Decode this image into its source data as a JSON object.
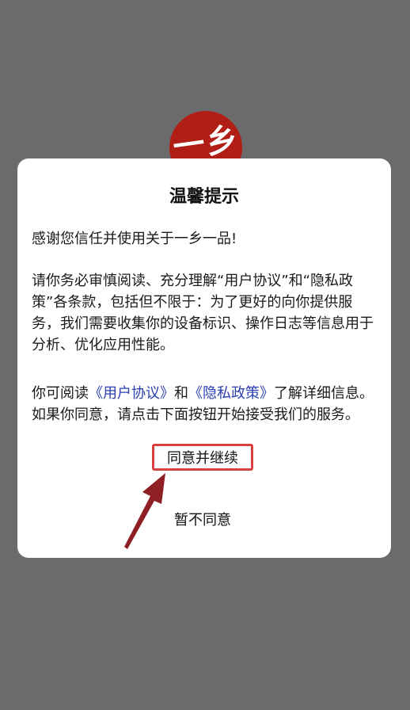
{
  "logo": {
    "text": "一乡"
  },
  "dialog": {
    "title": "温馨提示",
    "greeting": "感谢您信任并使用关于一乡一品!",
    "notice": "请你务必审慎阅读、充分理解“用户协议”和“隐私政策”各条款，包括但不限于：为了更好的向你提供服务，我们需要收集你的设备标识、操作日志等信息用于分析、优化应用性能。",
    "read_prefix": "你可阅读",
    "user_agreement_link": "《用户协议》",
    "and": "和",
    "privacy_policy_link": "《隐私政策》",
    "read_suffix": "了解详细信息。如果你同意，请点击下面按钮开始接受我们的服务。",
    "agree_button": "同意并继续",
    "disagree_button": "暂不同意"
  },
  "colors": {
    "backdrop": "#6b6b6b",
    "logo": "#b01e16",
    "link": "#2a3fb0",
    "highlight": "#d94040",
    "arrow": "#8e1f24"
  }
}
